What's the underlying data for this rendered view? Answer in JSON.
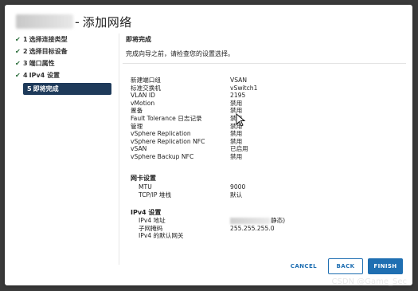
{
  "dialog": {
    "title": "添加网络"
  },
  "steps": [
    {
      "check": "✔",
      "num": "1",
      "label": "选择连接类型"
    },
    {
      "check": "✔",
      "num": "2",
      "label": "选择目标设备"
    },
    {
      "check": "✔",
      "num": "3",
      "label": "端口属性"
    },
    {
      "check": "✔",
      "num": "4",
      "label": "IPv4 设置"
    },
    {
      "check": "",
      "num": "5",
      "label": "即将完成"
    }
  ],
  "content": {
    "title": "即将完成",
    "subtitle": "完成向导之前，请检查您的设置选择。",
    "properties": [
      {
        "k": "新建端口组",
        "v": "VSAN"
      },
      {
        "k": "标准交换机",
        "v": "vSwitch1"
      },
      {
        "k": "VLAN ID",
        "v": "2195"
      },
      {
        "k": "vMotion",
        "v": "禁用"
      },
      {
        "k": "置备",
        "v": "禁用"
      },
      {
        "k": "Fault Tolerance 日志记录",
        "v": "禁用"
      },
      {
        "k": "管理",
        "v": "禁用"
      },
      {
        "k": "vSphere Replication",
        "v": "禁用"
      },
      {
        "k": "vSphere Replication NFC",
        "v": "禁用"
      },
      {
        "k": "vSAN",
        "v": "已启用"
      },
      {
        "k": "vSphere Backup NFC",
        "v": "禁用"
      }
    ],
    "nic_title": "网卡设置",
    "nic": [
      {
        "k": "MTU",
        "v": "9000"
      },
      {
        "k": "TCP/IP 堆栈",
        "v": "默认"
      }
    ],
    "ipv4_title": "IPv4 设置",
    "ipv4": [
      {
        "k": "IPv4 地址",
        "v": "静态)"
      },
      {
        "k": "子网掩码",
        "v": "255.255.255.0"
      },
      {
        "k": "IPv4 的默认网关",
        "v": ""
      }
    ]
  },
  "buttons": {
    "cancel": "CANCEL",
    "back": "BACK",
    "finish": "FINISH"
  },
  "watermark": "CSDN @Game_Sec",
  "colors": {
    "accent": "#1f6fb2",
    "active_step": "#1e3a5a",
    "check": "#2c6e3c"
  }
}
